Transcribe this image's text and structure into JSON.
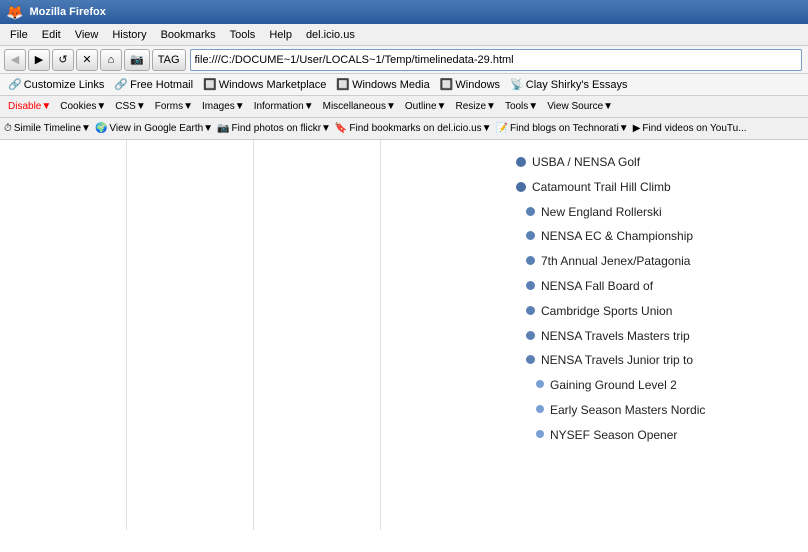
{
  "titlebar": {
    "icon": "🦊",
    "title": "Mozilla Firefox"
  },
  "menubar": {
    "items": [
      "File",
      "Edit",
      "View",
      "History",
      "Bookmarks",
      "Tools",
      "Help",
      "del.icio.us"
    ]
  },
  "navbar": {
    "back_label": "◀",
    "forward_label": "▶",
    "reload_label": "↺",
    "stop_label": "✕",
    "home_label": "⌂",
    "screenshot_label": "📷",
    "tag_label": "TAG",
    "address": "file:///C:/DOCUME~1/User/LOCALS~1/Temp/timelinedata-29.html",
    "go_label": "▶"
  },
  "bookmarks": {
    "customize": "Customize Links",
    "hotmail": "Free Hotmail",
    "marketplace": "Windows Marketplace",
    "media": "Windows Media",
    "windows": "Windows",
    "clay": "Clay Shirky's Essays"
  },
  "devbar": {
    "disable": "Disable▼",
    "cookies": "Cookies▼",
    "css": "CSS▼",
    "forms": "Forms▼",
    "images": "Images▼",
    "information": "Information▼",
    "miscellaneous": "Miscellaneous▼",
    "outline": "Outline▼",
    "resize": "Resize▼",
    "tools": "Tools▼",
    "viewsource": "View Source▼"
  },
  "similebar": {
    "simile": "Simile Timeline▼",
    "googleearth": "View in Google Earth▼",
    "flickr": "Find photos on flickr▼",
    "delicious": "Find bookmarks on del.icio.us▼",
    "technorati": "Find blogs on Technorati▼",
    "youtube": "Find videos on YouTu..."
  },
  "timeline": {
    "items": [
      {
        "label": "USBA / NENSA Golf",
        "level": 0
      },
      {
        "label": "Catamount Trail Hill Climb",
        "level": 0
      },
      {
        "label": "New England Rollerski",
        "level": 1
      },
      {
        "label": "NENSA EC & Championship",
        "level": 1
      },
      {
        "label": "7th Annual Jenex/Patagonia",
        "level": 1
      },
      {
        "label": "NENSA Fall Board of",
        "level": 1
      },
      {
        "label": "Cambridge Sports Union",
        "level": 1
      },
      {
        "label": "NENSA Travels Masters trip",
        "level": 1
      },
      {
        "label": "NENSA Travels Junior trip to",
        "level": 1
      },
      {
        "label": "Gaining Ground Level 2",
        "level": 2
      },
      {
        "label": "Early Season Masters Nordic",
        "level": 2
      },
      {
        "label": "NYSEF Season Opener",
        "level": 2
      }
    ]
  }
}
